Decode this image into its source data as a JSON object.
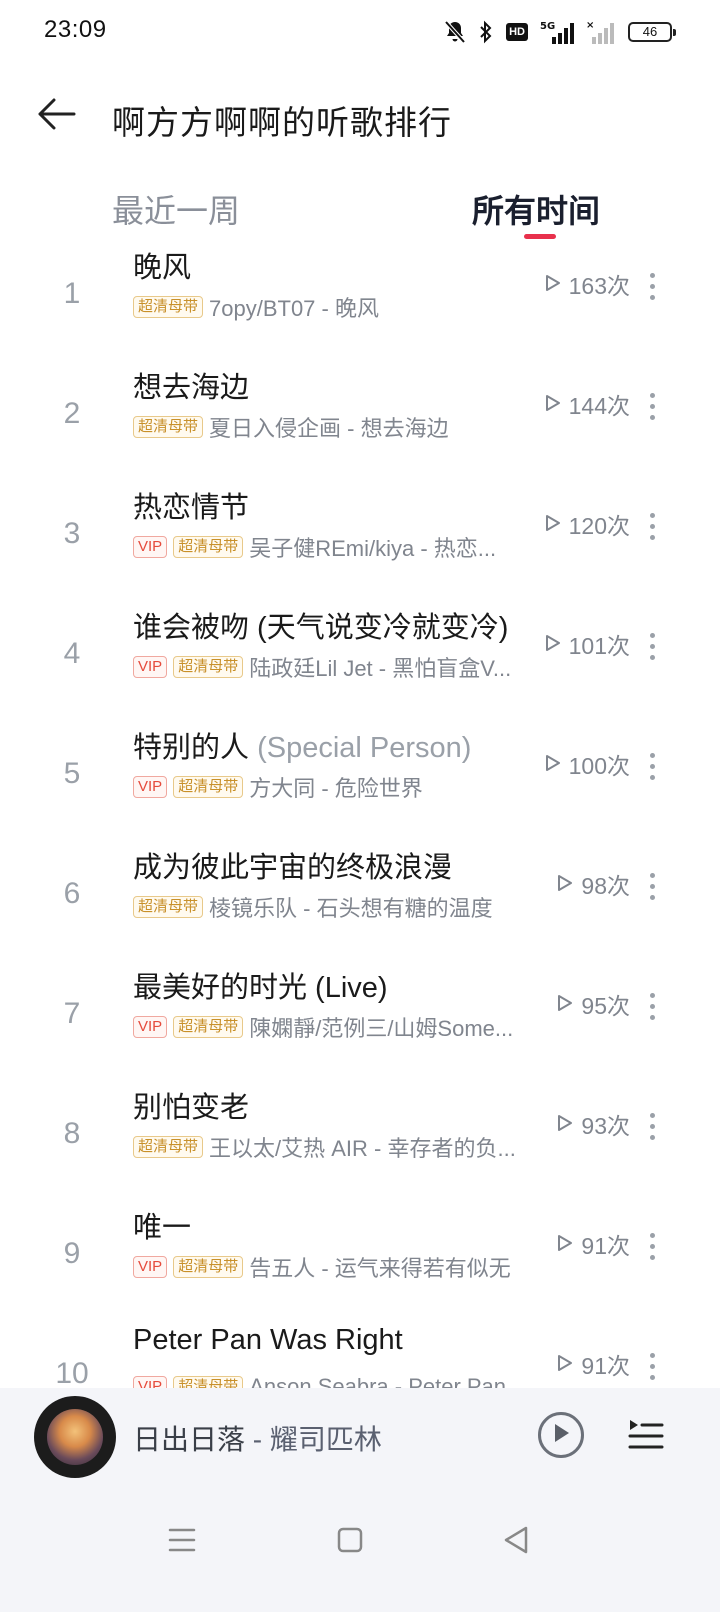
{
  "status_bar": {
    "time": "23:09",
    "hd_label": "HD",
    "network": "5G",
    "battery": "46",
    "icons": [
      "mute-bell-icon",
      "bluetooth-icon",
      "hd-icon",
      "signal-5g-icon",
      "signal-2-icon",
      "battery-icon"
    ]
  },
  "header": {
    "title": "啊方方啊啊的听歌排行",
    "back_icon": "arrow-left-icon"
  },
  "tabs": [
    {
      "label": "最近一周",
      "active": false
    },
    {
      "label": "所有时间",
      "active": true
    }
  ],
  "accent_color": "#e8304c",
  "tag_labels": {
    "vip": "VIP",
    "sq": "超清母带"
  },
  "songs": [
    {
      "rank": "1",
      "title": "晚风",
      "suffix": "",
      "vip": false,
      "sq": true,
      "desc": "7opy/BT07 - 晚风",
      "count": "163次"
    },
    {
      "rank": "2",
      "title": "想去海边",
      "suffix": "",
      "vip": false,
      "sq": true,
      "desc": "夏日入侵企画 - 想去海边",
      "count": "144次"
    },
    {
      "rank": "3",
      "title": "热恋情节",
      "suffix": "",
      "vip": true,
      "sq": true,
      "desc": "吴子健REmi/kiya - 热恋...",
      "count": "120次"
    },
    {
      "rank": "4",
      "title": "谁会被吻 (天气说变冷就变冷)",
      "suffix": "",
      "vip": true,
      "sq": true,
      "desc": "陆政廷Lil Jet - 黑怕盲盒V...",
      "count": "101次"
    },
    {
      "rank": "5",
      "title": "特别的人 ",
      "suffix": "(Special Person)",
      "vip": true,
      "sq": true,
      "desc": "方大同 - 危险世界",
      "count": "100次"
    },
    {
      "rank": "6",
      "title": "成为彼此宇宙的终极浪漫",
      "suffix": "",
      "vip": false,
      "sq": true,
      "desc": "棱镜乐队 - 石头想有糖的温度",
      "count": "98次"
    },
    {
      "rank": "7",
      "title": "最美好的时光 (Live)",
      "suffix": "",
      "vip": true,
      "sq": true,
      "desc": "陳嫻靜/范例三/山姆Some...",
      "count": "95次"
    },
    {
      "rank": "8",
      "title": "别怕变老",
      "suffix": "",
      "vip": false,
      "sq": true,
      "desc": "王以太/艾热 AIR - 幸存者的负...",
      "count": "93次"
    },
    {
      "rank": "9",
      "title": "唯一",
      "suffix": "",
      "vip": true,
      "sq": true,
      "desc": "告五人 - 运气来得若有似无",
      "count": "91次"
    },
    {
      "rank": "10",
      "title": "Peter Pan Was Right",
      "suffix": "",
      "vip": true,
      "sq": true,
      "desc": "Anson Seabra - Peter Pan...",
      "count": "91次"
    }
  ],
  "player": {
    "song": "日出日落",
    "separator": " - ",
    "artist": "耀司匹林",
    "play_icon": "play-circle-icon",
    "queue_icon": "playlist-icon"
  },
  "nav": {
    "icons": [
      "menu-icon",
      "home-square-icon",
      "back-triangle-icon"
    ]
  }
}
